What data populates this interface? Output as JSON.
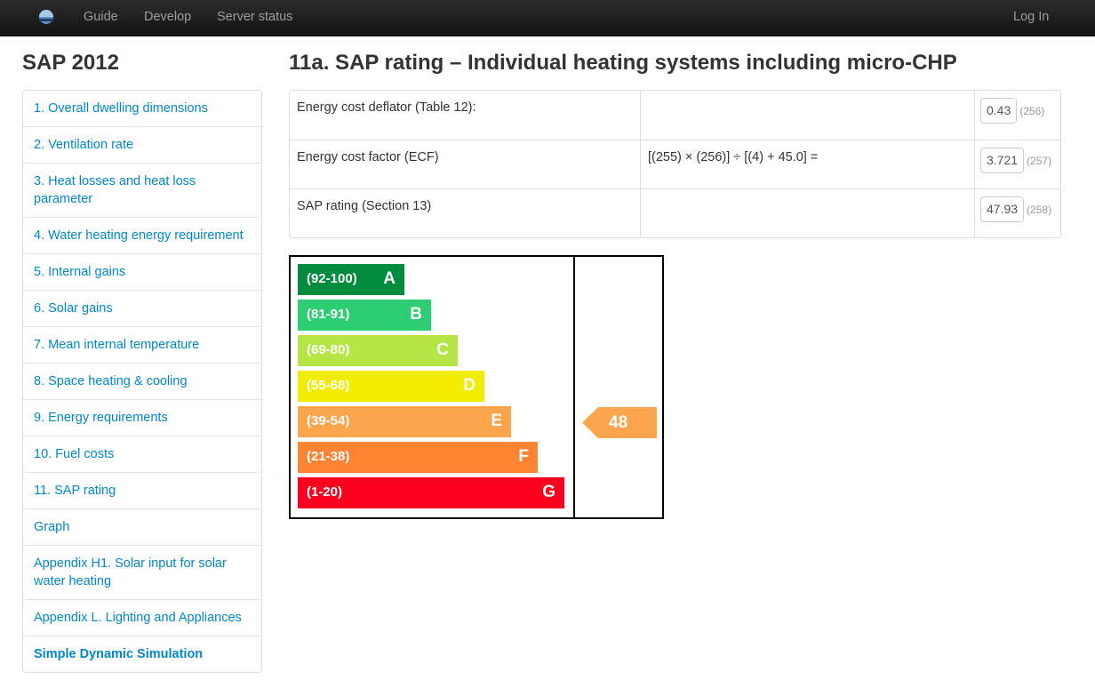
{
  "navbar": {
    "links": [
      "Guide",
      "Develop",
      "Server status"
    ],
    "login": "Log In"
  },
  "sidebar": {
    "title": "SAP 2012",
    "items": [
      "1. Overall dwelling dimensions",
      "2. Ventilation rate",
      "3. Heat losses and heat loss parameter",
      "4. Water heating energy requirement",
      "5. Internal gains",
      "6. Solar gains",
      "7. Mean internal temperature",
      "8. Space heating & cooling",
      "9. Energy requirements",
      "10. Fuel costs",
      "11. SAP rating",
      "Graph",
      "Appendix H1. Solar input for solar water heating",
      "Appendix L. Lighting and Appliances",
      "Simple Dynamic Simulation"
    ],
    "active_item": "Simple Dynamic Simulation"
  },
  "main": {
    "title": "11a. SAP rating – Individual heating systems including micro-CHP",
    "rows": [
      {
        "label": "Energy cost deflator (Table 12):",
        "formula": "",
        "value": "0.43",
        "ref": "(256)"
      },
      {
        "label": "Energy cost factor (ECF)",
        "formula": "[(255) × (256)] ÷ [(4) + 45.0] =",
        "value": "3.721",
        "ref": "(257)"
      },
      {
        "label": "SAP rating (Section 13)",
        "formula": "",
        "value": "47.93",
        "ref": "(258)"
      }
    ]
  },
  "rating_chart": {
    "bands": [
      {
        "range": "(92-100)",
        "letter": "A",
        "color": "#008c3f"
      },
      {
        "range": "(81-91)",
        "letter": "B",
        "color": "#2dcd73"
      },
      {
        "range": "(69-80)",
        "letter": "C",
        "color": "#b4e646"
      },
      {
        "range": "(55-68)",
        "letter": "D",
        "color": "#f1ec00"
      },
      {
        "range": "(39-54)",
        "letter": "E",
        "color": "#fca54c"
      },
      {
        "range": "(21-38)",
        "letter": "F",
        "color": "#fc8433"
      },
      {
        "range": "(1-20)",
        "letter": "G",
        "color": "#fc0020"
      }
    ],
    "current_rating": "48",
    "current_band": "E",
    "arrow_color": "#fca54c"
  }
}
